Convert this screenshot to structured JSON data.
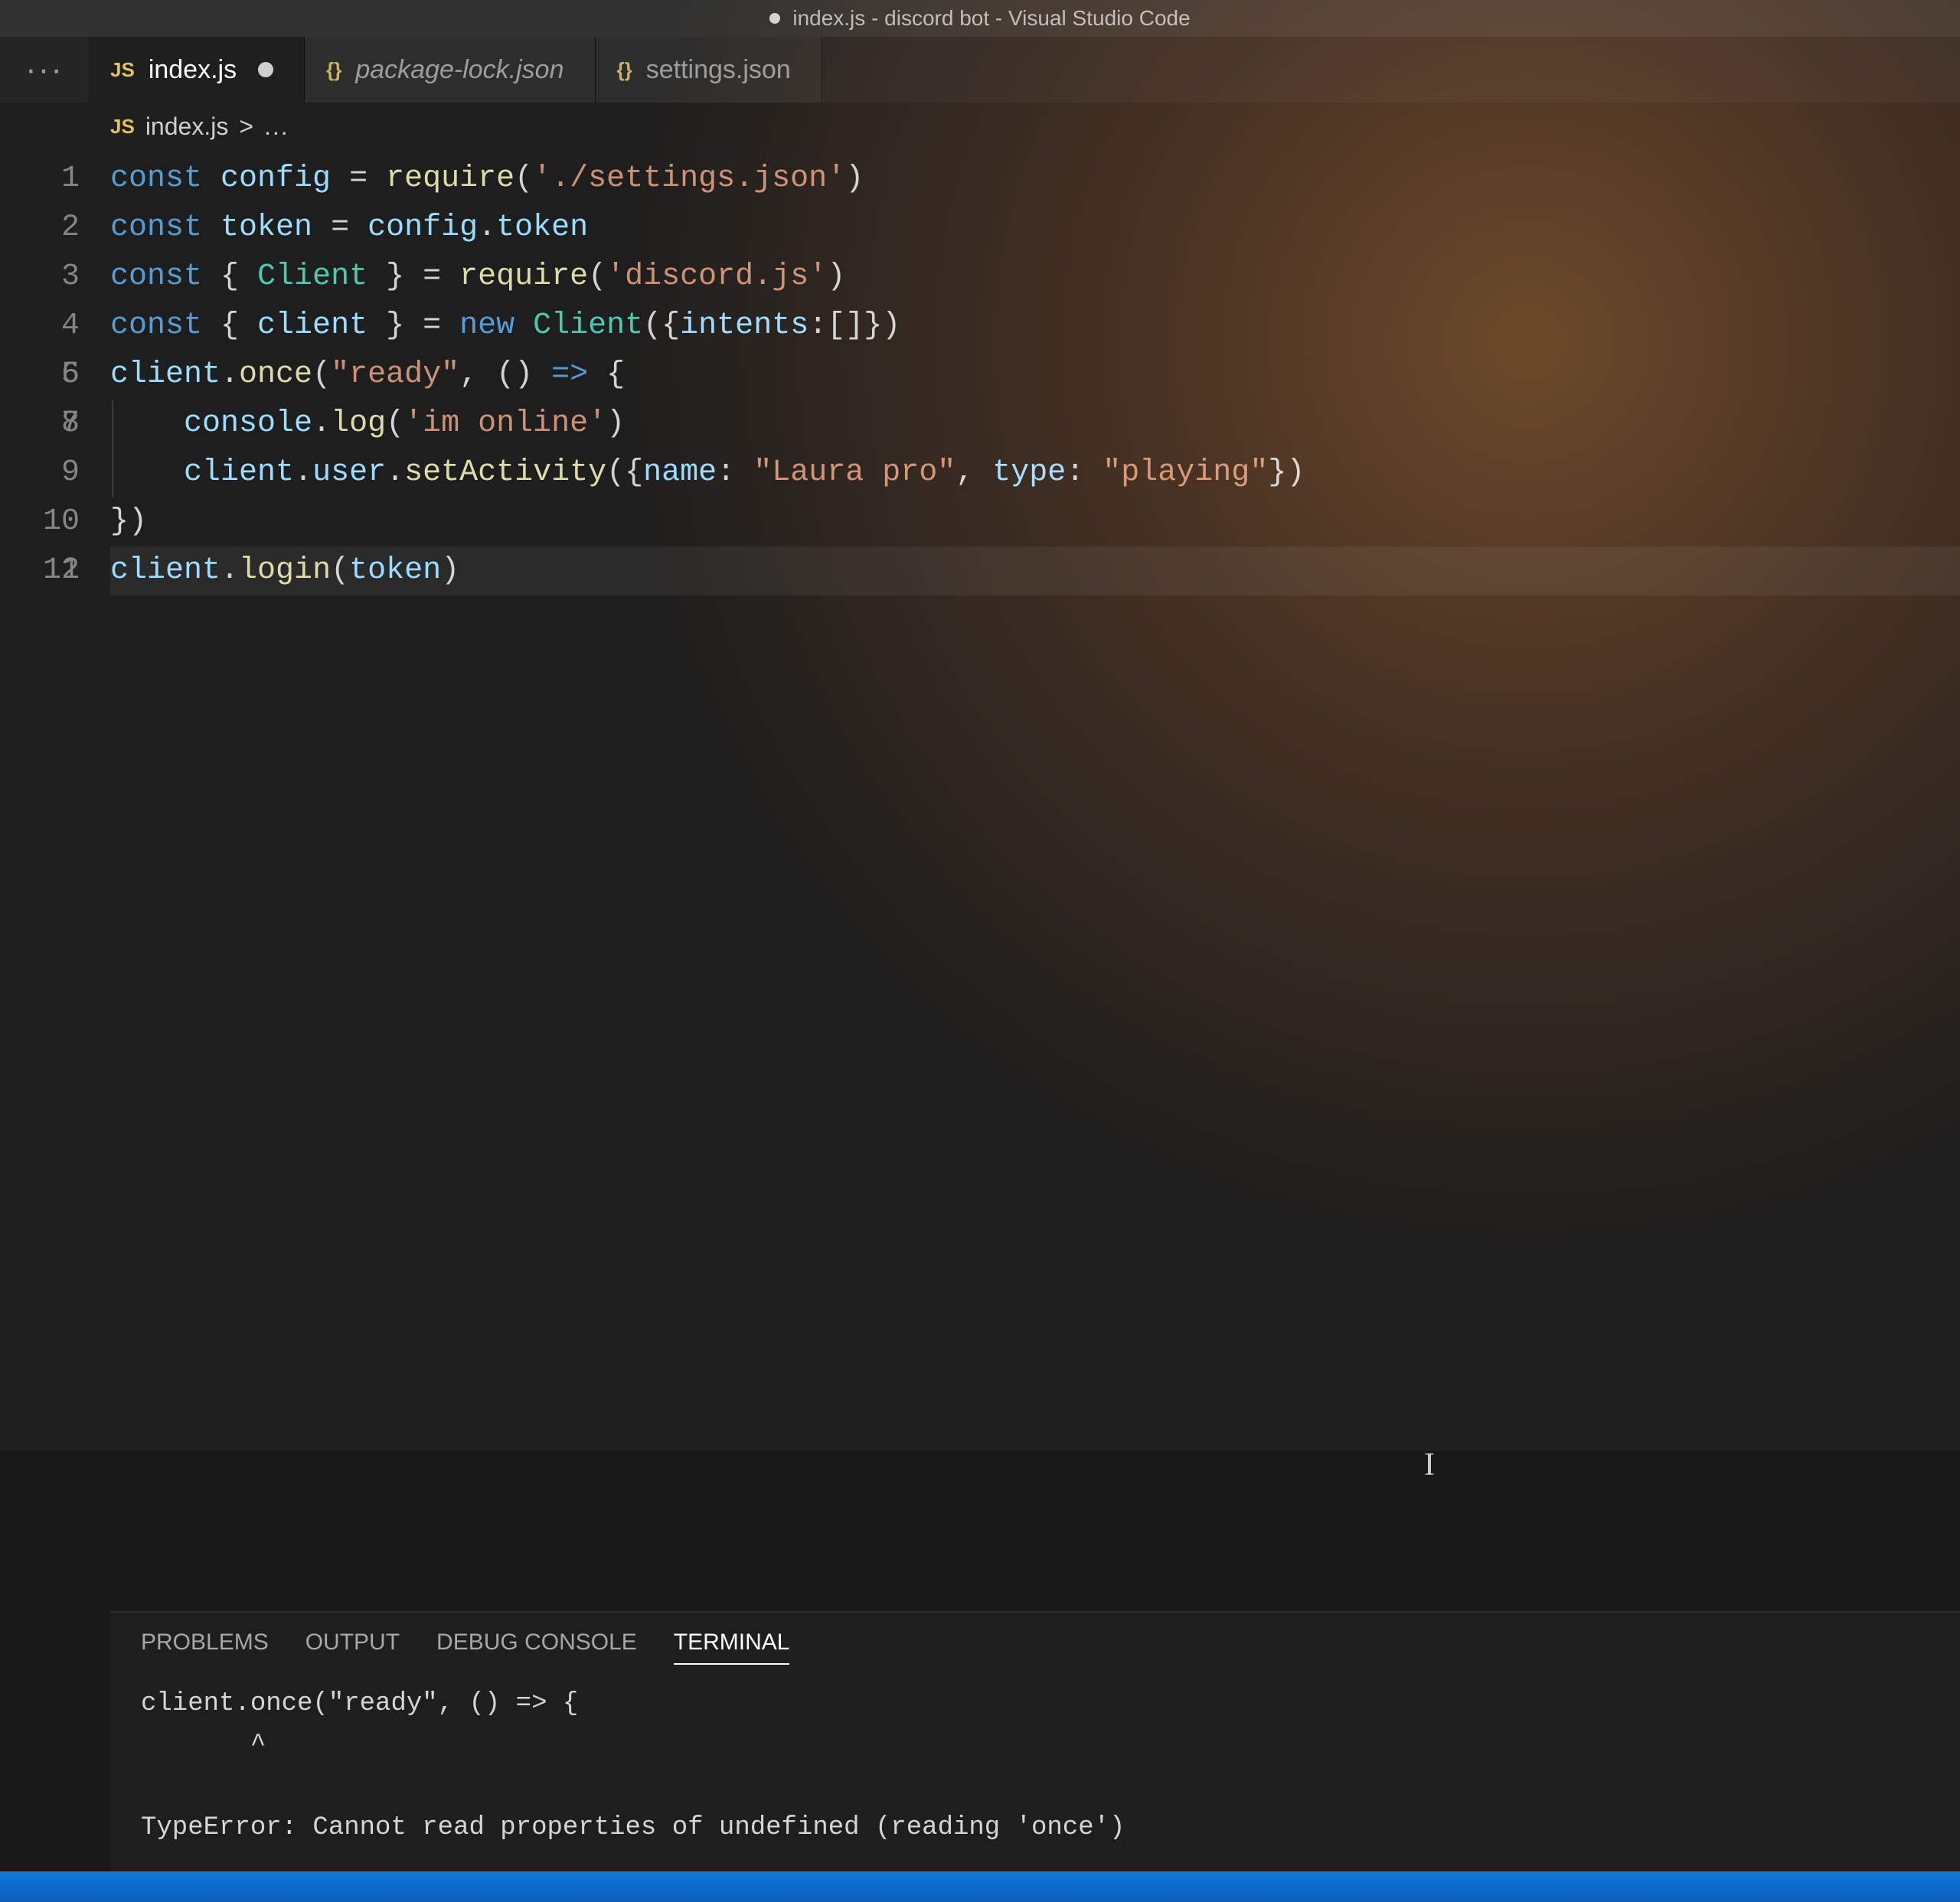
{
  "titlebar": {
    "title": "index.js - discord bot - Visual Studio Code"
  },
  "sidebarStub": "···",
  "tabs": [
    {
      "badge": "JS",
      "badgeClass": "lang-js",
      "name": "index.js",
      "active": true,
      "modified": true,
      "italic": false
    },
    {
      "badge": "{}",
      "badgeClass": "lang-json",
      "name": "package-lock.json",
      "active": false,
      "modified": false,
      "italic": true
    },
    {
      "badge": "{}",
      "badgeClass": "lang-json",
      "name": "settings.json",
      "active": false,
      "modified": false,
      "italic": false
    }
  ],
  "breadcrumb": {
    "badge": "JS",
    "file": "index.js",
    "sep": ">",
    "tail": "..."
  },
  "code": [
    {
      "n": 1,
      "segs": [
        [
          "kw",
          "const "
        ],
        [
          "vr",
          "config"
        ],
        [
          "pn",
          " = "
        ],
        [
          "fn",
          "require"
        ],
        [
          "pn",
          "("
        ],
        [
          "st",
          "'./settings.json'"
        ],
        [
          "pn",
          ")"
        ]
      ]
    },
    {
      "n": 2,
      "segs": [
        [
          "kw",
          "const "
        ],
        [
          "vr",
          "token"
        ],
        [
          "pn",
          " = "
        ],
        [
          "vr",
          "config"
        ],
        [
          "pn",
          "."
        ],
        [
          "pr",
          "token"
        ]
      ]
    },
    {
      "n": 3,
      "segs": [
        [
          "kw",
          "const "
        ],
        [
          "pn",
          "{ "
        ],
        [
          "cl",
          "Client"
        ],
        [
          "pn",
          " } = "
        ],
        [
          "fn",
          "require"
        ],
        [
          "pn",
          "("
        ],
        [
          "st",
          "'discord.js'"
        ],
        [
          "pn",
          ")"
        ]
      ]
    },
    {
      "n": 4,
      "segs": [
        [
          "kw",
          "const "
        ],
        [
          "pn",
          "{ "
        ],
        [
          "vr",
          "client"
        ],
        [
          "pn",
          " } = "
        ],
        [
          "kw",
          "new "
        ],
        [
          "cl",
          "Client"
        ],
        [
          "pn",
          "({"
        ],
        [
          "pr",
          "intents"
        ],
        [
          "pn",
          ":[]})"
        ]
      ]
    },
    {
      "n": 5,
      "segs": [
        [
          "pn",
          ""
        ]
      ]
    },
    {
      "n": 6,
      "segs": [
        [
          "vr",
          "client"
        ],
        [
          "pn",
          "."
        ],
        [
          "fn",
          "once"
        ],
        [
          "pn",
          "("
        ],
        [
          "st",
          "\"ready\""
        ],
        [
          "pn",
          ", () "
        ],
        [
          "kw",
          "=>"
        ],
        [
          "pn",
          " {"
        ]
      ]
    },
    {
      "n": 7,
      "indent": 1,
      "segs": [
        [
          "pn",
          ""
        ]
      ]
    },
    {
      "n": 8,
      "indent": 1,
      "segs": [
        [
          "pn",
          "    "
        ],
        [
          "vr",
          "console"
        ],
        [
          "pn",
          "."
        ],
        [
          "fn",
          "log"
        ],
        [
          "pn",
          "("
        ],
        [
          "st",
          "'im online'"
        ],
        [
          "pn",
          ")"
        ]
      ]
    },
    {
      "n": 9,
      "indent": 1,
      "segs": [
        [
          "pn",
          "    "
        ],
        [
          "vr",
          "client"
        ],
        [
          "pn",
          "."
        ],
        [
          "pr",
          "user"
        ],
        [
          "pn",
          "."
        ],
        [
          "fn",
          "setActivity"
        ],
        [
          "pn",
          "({"
        ],
        [
          "pr",
          "name"
        ],
        [
          "pn",
          ": "
        ],
        [
          "st",
          "\"Laura pro\""
        ],
        [
          "pn",
          ", "
        ],
        [
          "pr",
          "type"
        ],
        [
          "pn",
          ": "
        ],
        [
          "st",
          "\"playing\""
        ],
        [
          "pn",
          "})"
        ]
      ]
    },
    {
      "n": 10,
      "segs": [
        [
          "pn",
          "})"
        ]
      ]
    },
    {
      "n": 11,
      "segs": [
        [
          "pn",
          ""
        ]
      ]
    },
    {
      "n": 12,
      "hl": true,
      "segs": [
        [
          "vr",
          "client"
        ],
        [
          "pn",
          "."
        ],
        [
          "fn",
          "login"
        ],
        [
          "pn",
          "("
        ],
        [
          "vr",
          "token"
        ],
        [
          "pn",
          ")"
        ]
      ]
    }
  ],
  "panel": {
    "tabs": [
      {
        "label": "PROBLEMS",
        "active": false
      },
      {
        "label": "OUTPUT",
        "active": false
      },
      {
        "label": "DEBUG CONSOLE",
        "active": false
      },
      {
        "label": "TERMINAL",
        "active": true
      }
    ],
    "lines": [
      "client.once(\"ready\", () => {",
      "       ^",
      "",
      "TypeError: Cannot read properties of undefined (reading 'once')"
    ]
  },
  "ibeam": "I"
}
